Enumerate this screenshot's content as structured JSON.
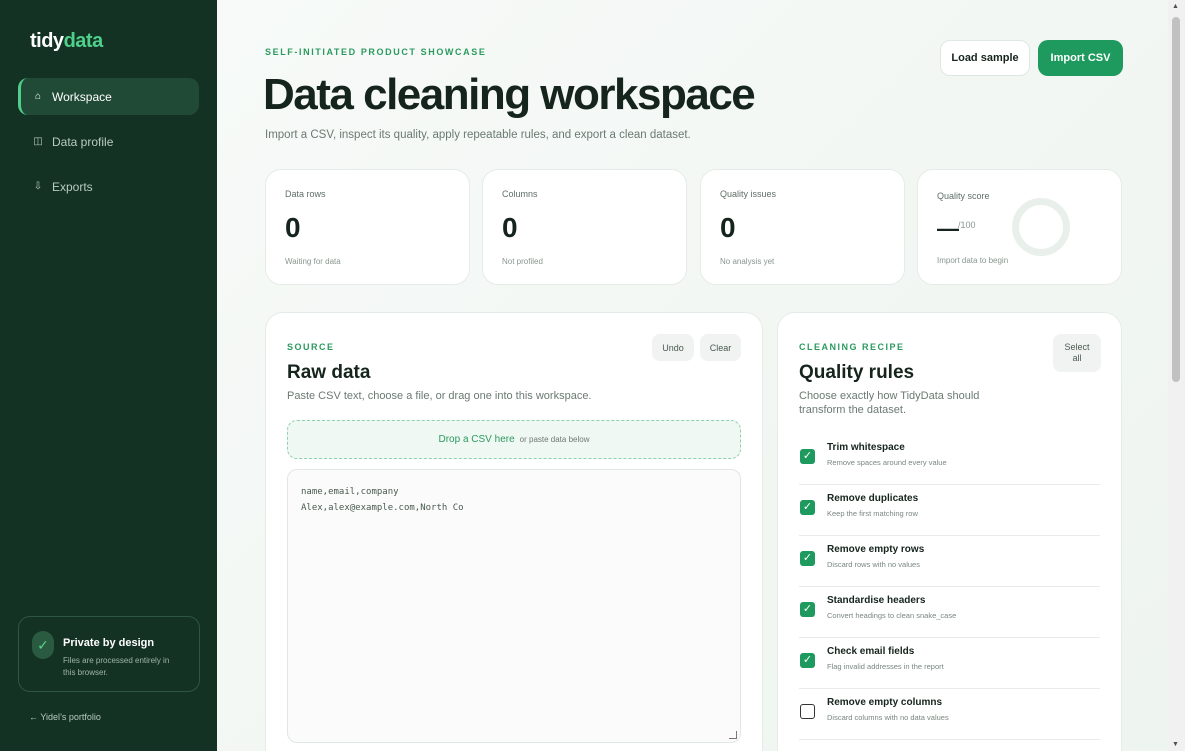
{
  "brand": {
    "part1": "tidy",
    "part2": "data",
    "accent": "#4fcf8a"
  },
  "sidebar": {
    "items": [
      {
        "label": "Workspace",
        "icon": "home-icon",
        "glyph": "⌂",
        "active": true
      },
      {
        "label": "Data profile",
        "icon": "columns-icon",
        "glyph": "◫",
        "active": false
      },
      {
        "label": "Exports",
        "icon": "download-icon",
        "glyph": "⇩",
        "active": false
      }
    ],
    "privacy": {
      "title": "Private by design",
      "desc": "Files are processed entirely in this browser."
    },
    "portfolio_link": "← Yidel’s portfolio"
  },
  "header": {
    "eyebrow": "SELF-INITIATED PRODUCT SHOWCASE",
    "title": "Data cleaning workspace",
    "subtitle": "Import a CSV, inspect its quality, apply repeatable rules, and export a clean dataset.",
    "load_sample": "Load sample",
    "import_csv": "Import CSV"
  },
  "stats": [
    {
      "label": "Data rows",
      "value": "0",
      "note": "Waiting for data"
    },
    {
      "label": "Columns",
      "value": "0",
      "note": "Not profiled"
    },
    {
      "label": "Quality issues",
      "value": "0",
      "note": "No analysis yet"
    }
  ],
  "quality_score": {
    "label": "Quality score",
    "value": "—",
    "out_of": "/100",
    "note": "Import data to begin"
  },
  "source": {
    "eyebrow": "SOURCE",
    "title": "Raw data",
    "desc": "Paste CSV text, choose a file, or drag one into this workspace.",
    "undo": "Undo",
    "clear": "Clear",
    "drop_main": "Drop a CSV here",
    "drop_sub": "or paste data below",
    "lines": [
      "name,email,company",
      "Alex,alex@example.com,North Co"
    ]
  },
  "recipe": {
    "eyebrow": "CLEANING RECIPE",
    "title": "Quality rules",
    "desc": "Choose exactly how TidyData should transform the dataset.",
    "select_all": "Select all",
    "rules": [
      {
        "title": "Trim whitespace",
        "desc": "Remove spaces around every value",
        "checked": true
      },
      {
        "title": "Remove duplicates",
        "desc": "Keep the first matching row",
        "checked": true
      },
      {
        "title": "Remove empty rows",
        "desc": "Discard rows with no values",
        "checked": true
      },
      {
        "title": "Standardise headers",
        "desc": "Convert headings to clean snake_case",
        "checked": true
      },
      {
        "title": "Check email fields",
        "desc": "Flag invalid addresses in the report",
        "checked": true
      },
      {
        "title": "Remove empty columns",
        "desc": "Discard columns with no data values",
        "checked": false
      }
    ]
  }
}
